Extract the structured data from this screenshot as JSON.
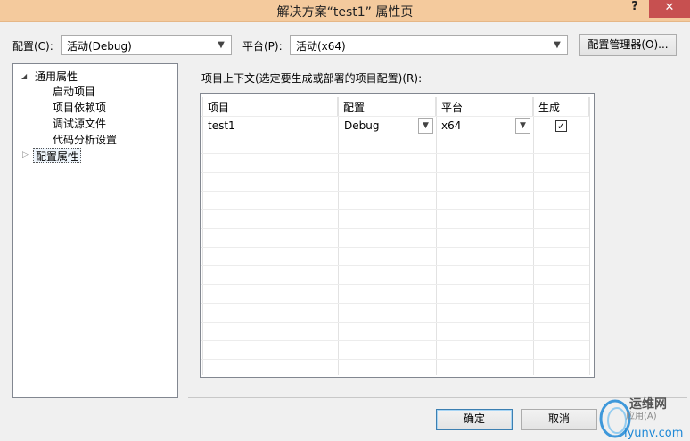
{
  "window": {
    "title": "解决方案“test1” 属性页",
    "help": "?",
    "close": "✕"
  },
  "toolbar": {
    "config_label": "配置(C):",
    "config_value": "活动(Debug)",
    "platform_label": "平台(P):",
    "platform_value": "活动(x64)",
    "config_manager_button": "配置管理器(O)..."
  },
  "tree": {
    "common_props": "通用属性",
    "children": [
      "启动项目",
      "项目依赖项",
      "调试源文件",
      "代码分析设置"
    ],
    "config_props": "配置属性"
  },
  "main": {
    "context_label": "项目上下文(选定要生成或部署的项目配置)(R):",
    "columns": [
      "项目",
      "配置",
      "平台",
      "生成"
    ],
    "rows": [
      {
        "project": "test1",
        "config": "Debug",
        "platform": "x64",
        "build": true
      }
    ]
  },
  "footer": {
    "ok": "确定",
    "cancel": "取消"
  },
  "watermark": {
    "text1": "运维网",
    "text2": "iyunv.com",
    "text3": "应用(A)"
  },
  "colors": {
    "titlebar": "#f4ca9d",
    "close": "#c75050",
    "accent": "#3c7fb1",
    "watermark": "#1e88d6"
  }
}
